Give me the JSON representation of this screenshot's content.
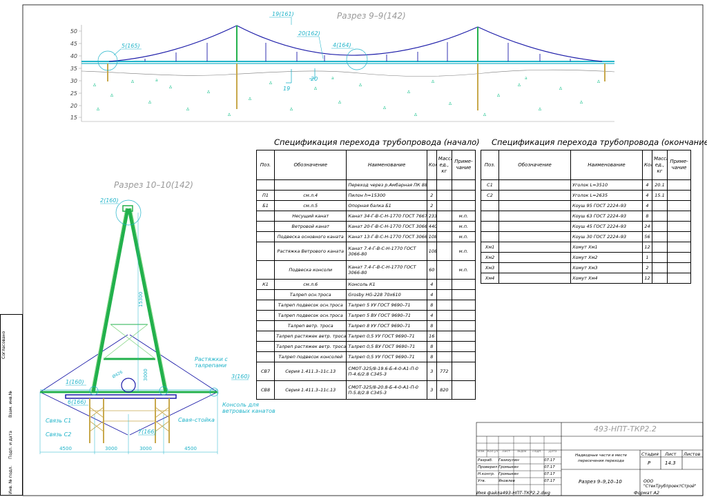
{
  "colors": {
    "cable": "#1a1aa8",
    "pipe": "#1fb3c9",
    "pylon": "#22b14c",
    "pile": "#c8a84b",
    "soil": "#34c99b",
    "annotation": "#1fb3c9",
    "section": "#9a9a9a"
  },
  "section99": {
    "title": "Разрез 9–9(142)",
    "y_ticks": [
      "50",
      "45",
      "40",
      "35",
      "30",
      "25",
      "20",
      "15"
    ],
    "callouts": [
      "19(161)",
      "20(162)",
      "4(164)",
      "5(165)"
    ],
    "marks": [
      "19",
      "20"
    ]
  },
  "section1010": {
    "title": "Разрез 10–10(142)",
    "callouts": [
      "2(160)",
      "1(160)",
      "6(166)",
      "3(160)",
      "7(166)"
    ],
    "height_dim": "15300",
    "inner_dim": "3000",
    "diam": "Ø426",
    "labels": {
      "guys": "Растяжки с\nталрепами",
      "console": "Консоль для\nветровых канатов",
      "link1": "Связь С1",
      "link2": "Связь С2",
      "pile": "Свая–стойка"
    },
    "bottom_dims": [
      "4500",
      "3000",
      "3000",
      "4500"
    ]
  },
  "spec_start": {
    "title": "Спецификация перехода трубопровода (начало)",
    "header": [
      "Поз.",
      "Обозначение",
      "Наименование",
      "Кол.",
      "Масса ед., кг",
      "Приме- чание"
    ],
    "rows": [
      [
        "",
        "",
        "Переход через р.Амбарная ПК 880",
        "",
        "",
        ""
      ],
      [
        "П1",
        "см.л.4",
        "Пилон h=15300",
        "2",
        "",
        ""
      ],
      [
        "Б1",
        "см.л.5",
        "Опорная балка Б1",
        "2",
        "",
        ""
      ],
      [
        "",
        "Несущий канат",
        "Канат 34-Г-В-С-Н-1770 ГОСТ 7667-80",
        "233",
        "",
        "м.п."
      ],
      [
        "",
        "Ветровой канат",
        "Канат 20-Г-В-С-Н-1770 ГОСТ 3066-80",
        "440",
        "",
        "м.п."
      ],
      [
        "",
        "Подвеска основного каната",
        "Канат 13-Г-В-С-Н-1770 ГОСТ 3066-80",
        "108",
        "",
        "м.п."
      ],
      [
        "",
        "Растяжка Ветрового каната",
        "Канат 7.4-Г-В-С-Н-1770 ГОСТ 3066-80",
        "108",
        "",
        "м.п."
      ],
      [
        "",
        "Подвеска консоли",
        "Канат 7.4-Г-В-С-Н-1770 ГОСТ 3066-80",
        "60",
        "",
        "м.п."
      ],
      [
        "К1",
        "см.л.6",
        "Консоль К1",
        "4",
        "",
        ""
      ],
      [
        "",
        "Талреп осн.троса",
        "Grosby HG-228 70х610",
        "4",
        "",
        ""
      ],
      [
        "",
        "Талреп подвесок осн.троса",
        "Талреп 5 УУ ГОСТ 9690–71",
        "8",
        "",
        ""
      ],
      [
        "",
        "Талреп подвесок осн.троса",
        "Талреп 5 ВУ ГОСТ 9690–71",
        "4",
        "",
        ""
      ],
      [
        "",
        "Талреп ветр. троса",
        "Талреп 8 УУ ГОСТ 9690–71",
        "8",
        "",
        ""
      ],
      [
        "",
        "Талреп растяжек ветр. троса",
        "Талреп 0,5 УУ ГОСТ 9690–71",
        "16",
        "",
        ""
      ],
      [
        "",
        "Талреп растяжек ветр. троса",
        "Талреп 0,5 ВУ ГОСТ 9690–71",
        "8",
        "",
        ""
      ],
      [
        "",
        "Талреп подвесок консолей",
        "Талреп 0,5 УУ ГОСТ 9690–71",
        "8",
        "",
        ""
      ],
      [
        "СВ7",
        "Серия 1.411.3–11с.13",
        "СМОТ-325/8-19.6-Б-4-0-А1-П-0 П-4.6/2.8 С345-3",
        "3",
        "772",
        ""
      ],
      [
        "СВ8",
        "Серия 1.411.3–11с.13",
        "СМОТ-325/8-20.8-Б-4-0-А1-П-0 П-5.8/2.8 С345-3",
        "3",
        "820",
        ""
      ]
    ]
  },
  "spec_end": {
    "title": "Спецификация перехода трубопровода (окончание)",
    "header": [
      "Поз.",
      "Обозначение",
      "Наименование",
      "Кол.",
      "Масса ед., кг",
      "Приме- чание"
    ],
    "rows": [
      [
        "С1",
        "",
        "Уголок L=3510",
        "4",
        "20.1",
        ""
      ],
      [
        "С2",
        "",
        "Уголок L=2635",
        "4",
        "15.1",
        ""
      ],
      [
        "",
        "",
        "Коуш 95 ГОСТ 2224–93",
        "4",
        "",
        ""
      ],
      [
        "",
        "",
        "Коуш 63 ГОСТ 2224–93",
        "8",
        "",
        ""
      ],
      [
        "",
        "",
        "Коуш 45 ГОСТ 2224–93",
        "24",
        "",
        ""
      ],
      [
        "",
        "",
        "Коуш 30 ГОСТ 2224–93",
        "56",
        "",
        ""
      ],
      [
        "Хм1",
        "",
        "Хомут Хм1",
        "12",
        "",
        ""
      ],
      [
        "Хм2",
        "",
        "Хомут Хм2",
        "1",
        "",
        ""
      ],
      [
        "Хм3",
        "",
        "Хомут Хм3",
        "2",
        "",
        ""
      ],
      [
        "Хм4",
        "",
        "Хомут Хм4",
        "12",
        "",
        ""
      ]
    ]
  },
  "stamp": {
    "code": "493-НПТ-ТКР2.2",
    "stage_label": "Стадия",
    "sheet_label": "Лист",
    "sheets_label": "Листов",
    "stage": "Р",
    "sheet": "14.3",
    "drawing": "Разрез 9–9,10–10",
    "company": "ООО \"СтекТрубпроектСтрой\"",
    "subject": "Надводные части в месте пересечения перехода",
    "roles": [
      "Разраб.",
      "Проверил",
      "",
      "Н.контр.",
      "Утв."
    ],
    "names": [
      "Газизулин",
      "Громыкин",
      "",
      "Громыкин",
      "Яковлев"
    ],
    "dates": [
      "07.17",
      "07.17",
      "",
      "07.17",
      "07.17"
    ],
    "head": [
      "Изм.",
      "Кол.уч",
      "Лист",
      "№док",
      "Подп.",
      "Дата"
    ],
    "filename": "Имя файла493-НПТ-ТКР2.2.dwg",
    "format": "Формат А2"
  },
  "side_labels": [
    "Согласовано",
    "Взам. инв.№",
    "Подп. и дата",
    "Инв. № подл."
  ]
}
